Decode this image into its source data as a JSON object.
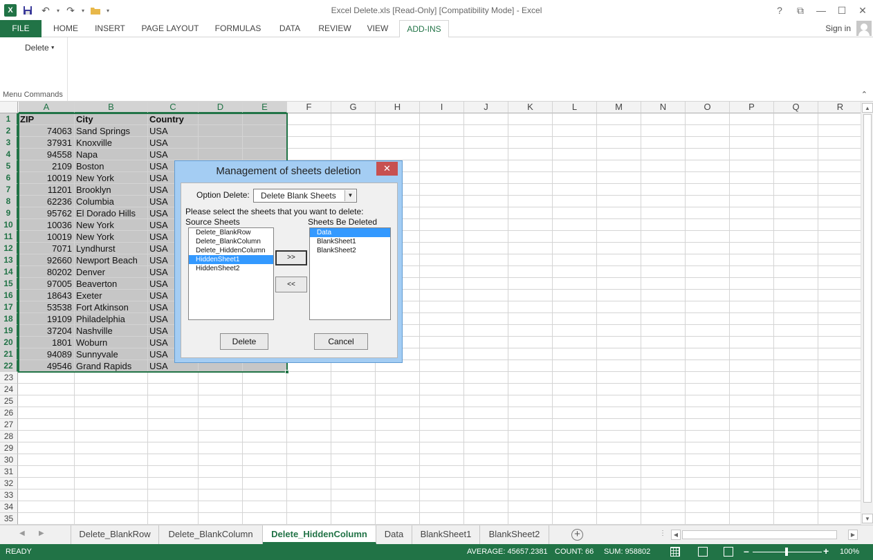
{
  "window": {
    "title": "Excel Delete.xls  [Read-Only]  [Compatibility Mode] - Excel",
    "controls": [
      "?",
      "⧉",
      "—",
      "☐",
      "✕"
    ]
  },
  "ribbon": {
    "tabs": [
      "FILE",
      "HOME",
      "INSERT",
      "PAGE LAYOUT",
      "FORMULAS",
      "DATA",
      "REVIEW",
      "VIEW",
      "ADD-INS"
    ],
    "active_tab": "ADD-INS",
    "signin": "Sign in",
    "delete_menu": "Delete",
    "group_label": "Menu Commands"
  },
  "grid": {
    "columns": [
      "A",
      "B",
      "C",
      "D",
      "E",
      "F",
      "G",
      "H",
      "I",
      "J",
      "K",
      "L",
      "M",
      "N",
      "O",
      "P",
      "Q",
      "R"
    ],
    "row_numbers": [
      "1",
      "2",
      "3",
      "4",
      "5",
      "6",
      "7",
      "8",
      "9",
      "10",
      "11",
      "12",
      "13",
      "14",
      "15",
      "16",
      "17",
      "18",
      "19",
      "20",
      "21",
      "22",
      "23",
      "24",
      "25",
      "26",
      "27",
      "28",
      "29",
      "30",
      "31",
      "32",
      "33",
      "34",
      "35"
    ],
    "header": [
      "ZIP",
      "City",
      "Country"
    ],
    "rows": [
      [
        "74063",
        "Sand Springs",
        "USA"
      ],
      [
        "37931",
        "Knoxville",
        "USA"
      ],
      [
        "94558",
        "Napa",
        "USA"
      ],
      [
        "2109",
        "Boston",
        "USA"
      ],
      [
        "10019",
        "New York",
        "USA"
      ],
      [
        "11201",
        "Brooklyn",
        "USA"
      ],
      [
        "62236",
        "Columbia",
        "USA"
      ],
      [
        "95762",
        "El Dorado Hills",
        "USA"
      ],
      [
        "10036",
        "New York",
        "USA"
      ],
      [
        "10019",
        "New York",
        "USA"
      ],
      [
        "7071",
        "Lyndhurst",
        "USA"
      ],
      [
        "92660",
        "Newport Beach",
        "USA"
      ],
      [
        "80202",
        "Denver",
        "USA"
      ],
      [
        "97005",
        "Beaverton",
        "USA"
      ],
      [
        "18643",
        "Exeter",
        "USA"
      ],
      [
        "53538",
        "Fort Atkinson",
        "USA"
      ],
      [
        "19109",
        "Philadelphia",
        "USA"
      ],
      [
        "37204",
        "Nashville",
        "USA"
      ],
      [
        "1801",
        "Woburn",
        "USA"
      ],
      [
        "94089",
        "Sunnyvale",
        "USA"
      ],
      [
        "49546",
        "Grand Rapids",
        "USA"
      ]
    ]
  },
  "dialog": {
    "title": "Management of sheets deletion",
    "close": "✕",
    "option_label": "Option Delete:",
    "option_value": "Delete Blank Sheets",
    "instruction": "Please select the sheets that you want to delete:",
    "source_label": "Source Sheets",
    "target_label": "Sheets Be Deleted",
    "source_items": [
      "Delete_BlankRow",
      "Delete_BlankColumn",
      "Delete_HiddenColumn",
      "HiddenSheet1",
      "HiddenSheet2"
    ],
    "source_selected": "HiddenSheet1",
    "target_items": [
      "Data",
      "BlankSheet1",
      "BlankSheet2"
    ],
    "target_selected": "Data",
    "add_button": ">>",
    "remove_button": "<<",
    "delete_button": "Delete",
    "cancel_button": "Cancel"
  },
  "sheets": {
    "tabs": [
      "Delete_BlankRow",
      "Delete_BlankColumn",
      "Delete_HiddenColumn",
      "Data",
      "BlankSheet1",
      "BlankSheet2"
    ],
    "active": "Delete_HiddenColumn"
  },
  "status": {
    "ready": "READY",
    "average": "AVERAGE: 45657.2381",
    "count": "COUNT: 66",
    "sum": "SUM: 958802",
    "zoom": "100%"
  },
  "colors": {
    "excel_green": "#217346",
    "dialog_frame": "#a4cdf3",
    "selection_fill": "#c6c6c6",
    "list_highlight": "#3399ff"
  }
}
